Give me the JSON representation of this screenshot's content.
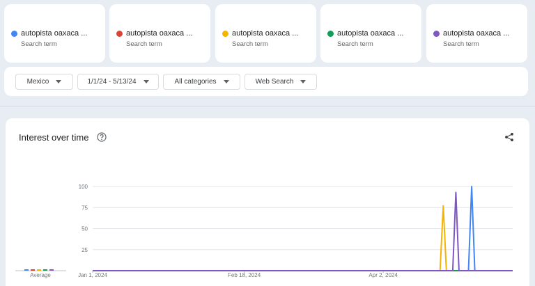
{
  "terms": [
    {
      "name": "autopista oaxaca ...",
      "sub": "Search term",
      "color": "#4285f4"
    },
    {
      "name": "autopista oaxaca ...",
      "sub": "Search term",
      "color": "#db4437"
    },
    {
      "name": "autopista oaxaca ...",
      "sub": "Search term",
      "color": "#f4b400"
    },
    {
      "name": "autopista oaxaca ...",
      "sub": "Search term",
      "color": "#0f9d58"
    },
    {
      "name": "autopista oaxaca ...",
      "sub": "Search term",
      "color": "#7e57c2"
    }
  ],
  "filters": {
    "region": "Mexico",
    "date_range": "1/1/24 - 5/13/24",
    "category": "All categories",
    "search_type": "Web Search"
  },
  "panel": {
    "title": "Interest over time",
    "help_icon": "help-circle-icon",
    "share_icon": "share-icon"
  },
  "chart_data": {
    "type": "line",
    "title": "Interest over time",
    "average_label": "Average",
    "ylim": [
      0,
      100
    ],
    "y_ticks": [
      "100",
      "75",
      "50",
      "25"
    ],
    "y_tick_values": [
      100,
      75,
      50,
      25
    ],
    "x_tick_labels": [
      "Jan 1, 2024",
      "Feb 18, 2024",
      "Apr 2, 2024"
    ],
    "x_tick_index": [
      0,
      48,
      92
    ],
    "x_count": 134,
    "grid": true,
    "series": [
      {
        "color": "#4285f4",
        "points": [
          [
            0,
            0
          ],
          [
            119,
            0
          ],
          [
            120,
            100
          ],
          [
            121,
            0
          ],
          [
            133,
            0
          ]
        ]
      },
      {
        "color": "#db4437",
        "points": [
          [
            0,
            0
          ],
          [
            133,
            0
          ]
        ]
      },
      {
        "color": "#f4b400",
        "points": [
          [
            0,
            0
          ],
          [
            110,
            0
          ],
          [
            111,
            77
          ],
          [
            112,
            0
          ],
          [
            133,
            0
          ]
        ]
      },
      {
        "color": "#0f9d58",
        "points": [
          [
            0,
            0
          ],
          [
            133,
            0
          ]
        ]
      },
      {
        "color": "#7e57c2",
        "points": [
          [
            0,
            0
          ],
          [
            114,
            0
          ],
          [
            115,
            93
          ],
          [
            116,
            0
          ],
          [
            133,
            0
          ]
        ]
      }
    ]
  }
}
